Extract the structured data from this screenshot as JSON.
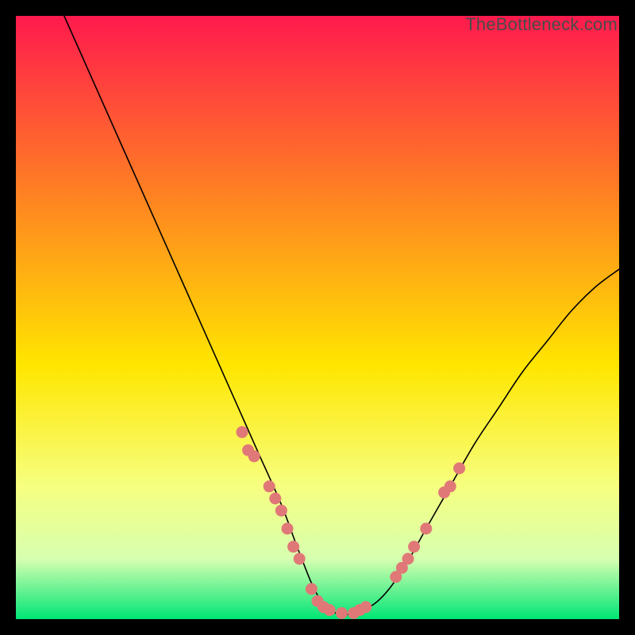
{
  "watermark": "TheBottleneck.com",
  "chart_data": {
    "type": "line",
    "title": "",
    "xlabel": "",
    "ylabel": "",
    "xlim": [
      0,
      100
    ],
    "ylim": [
      0,
      100
    ],
    "background_gradient": {
      "top": "#ff1a4d",
      "mid1": "#ff8a1f",
      "mid2": "#ffe600",
      "mid3": "#f6ff80",
      "mid4": "#d7ffb0",
      "bottom": "#00e676"
    },
    "series": [
      {
        "name": "bottleneck-curve",
        "x": [
          8,
          12,
          16,
          20,
          24,
          28,
          32,
          36,
          40,
          44,
          47,
          50,
          53,
          56,
          60,
          64,
          68,
          72,
          76,
          80,
          84,
          88,
          92,
          96,
          100
        ],
        "y": [
          100,
          91,
          82,
          73,
          64,
          55,
          46,
          37,
          28,
          19,
          11,
          4,
          1,
          1,
          3,
          8,
          15,
          22,
          29,
          35,
          41,
          46,
          51,
          55,
          58
        ]
      }
    ],
    "markers": {
      "name": "highlighted-points",
      "color": "#e07878",
      "points": [
        {
          "x": 37.5,
          "y": 31
        },
        {
          "x": 38.5,
          "y": 28
        },
        {
          "x": 39.5,
          "y": 27
        },
        {
          "x": 42,
          "y": 22
        },
        {
          "x": 43,
          "y": 20
        },
        {
          "x": 44,
          "y": 18
        },
        {
          "x": 45,
          "y": 15
        },
        {
          "x": 46,
          "y": 12
        },
        {
          "x": 47,
          "y": 10
        },
        {
          "x": 49,
          "y": 5
        },
        {
          "x": 50,
          "y": 3
        },
        {
          "x": 51,
          "y": 2
        },
        {
          "x": 52,
          "y": 1.5
        },
        {
          "x": 54,
          "y": 1
        },
        {
          "x": 56,
          "y": 1
        },
        {
          "x": 57,
          "y": 1.5
        },
        {
          "x": 58,
          "y": 2
        },
        {
          "x": 63,
          "y": 7
        },
        {
          "x": 64,
          "y": 8.5
        },
        {
          "x": 65,
          "y": 10
        },
        {
          "x": 66,
          "y": 12
        },
        {
          "x": 68,
          "y": 15
        },
        {
          "x": 71,
          "y": 21
        },
        {
          "x": 72,
          "y": 22
        },
        {
          "x": 73.5,
          "y": 25
        }
      ]
    }
  }
}
